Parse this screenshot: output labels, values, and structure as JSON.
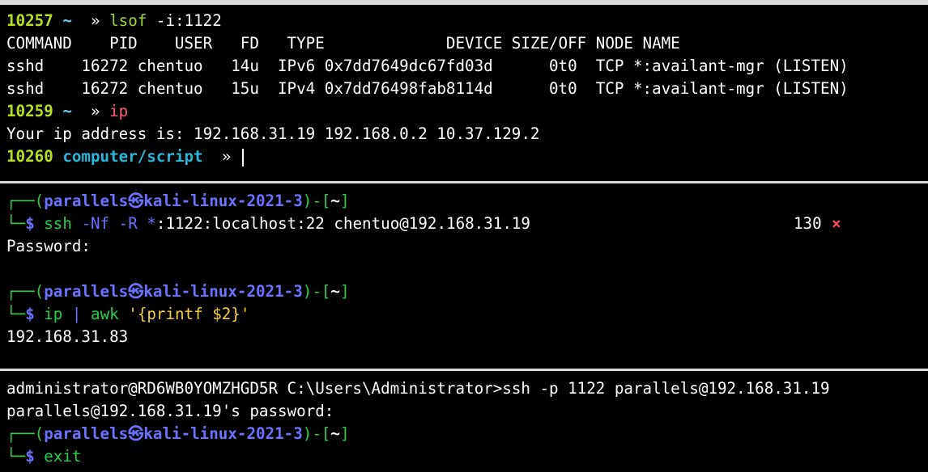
{
  "pane1": {
    "line1": {
      "num": "10257",
      "cwd": "~",
      "arrow": "»",
      "cmd": "lsof",
      "args": "-i:1122"
    },
    "table_header": "COMMAND    PID    USER   FD   TYPE             DEVICE SIZE/OFF NODE NAME",
    "rows": [
      "sshd    16272 chentuo   14u  IPv6 0x7dd7649dc67fd03d      0t0  TCP *:availant-mgr (LISTEN)",
      "sshd    16272 chentuo   15u  IPv4 0x7dd76498fab8114d      0t0  TCP *:availant-mgr (LISTEN)"
    ],
    "line2": {
      "num": "10259",
      "cwd": "~",
      "arrow": "»",
      "cmd": "ip"
    },
    "ip_output": "Your ip address is: 192.168.31.19 192.168.0.2 10.37.129.2",
    "line3": {
      "num": "10260",
      "cwd": "computer/script",
      "arrow": "»"
    }
  },
  "pane2": {
    "prompt1": {
      "open": "┌──(",
      "user": "parallels㉿kali-linux-2021-3",
      "mid": ")-[",
      "dir": "~",
      "close": "]",
      "bottom": "└─",
      "dollar": "$"
    },
    "cmd1": {
      "bin": "ssh",
      "opt1": "-Nf",
      "opt2": "-R",
      "star": "*",
      "rest": ":1122:localhost:22 chentuo@192.168.31.19"
    },
    "status_code": "130",
    "status_x": "×",
    "password": "Password:",
    "prompt2": {
      "open": "┌──(",
      "user": "parallels㉿kali-linux-2021-3",
      "mid": ")-[",
      "dir": "~",
      "close": "]",
      "bottom": "└─",
      "dollar": "$"
    },
    "cmd2": {
      "bin": "ip",
      "pipe": "|",
      "awk": "awk",
      "q1": "'",
      "brace": "{",
      "body": "printf $2",
      "brace2": "}",
      "q2": "'"
    },
    "output": "192.168.31.83"
  },
  "pane3": {
    "win_line": "administrator@RD6WB0YOMZHGD5R C:\\Users\\Administrator>ssh -p 1122 parallels@192.168.31.19",
    "pw_line": "parallels@192.168.31.19's password:",
    "prompt": {
      "open": "┌──(",
      "user": "parallels㉿kali-linux-2021-3",
      "mid": ")-[",
      "dir": "~",
      "close": "]",
      "bottom": "└─",
      "dollar": "$"
    },
    "cmd": "exit"
  },
  "colors": {
    "background": "#000000",
    "separator": "#d8d8d8",
    "zsh_number": "#b4e01f",
    "zsh_path": "#29b8db",
    "kali_green": "#23d14b",
    "kali_blue": "#6a72ff",
    "error_red": "#ff4d4d"
  }
}
